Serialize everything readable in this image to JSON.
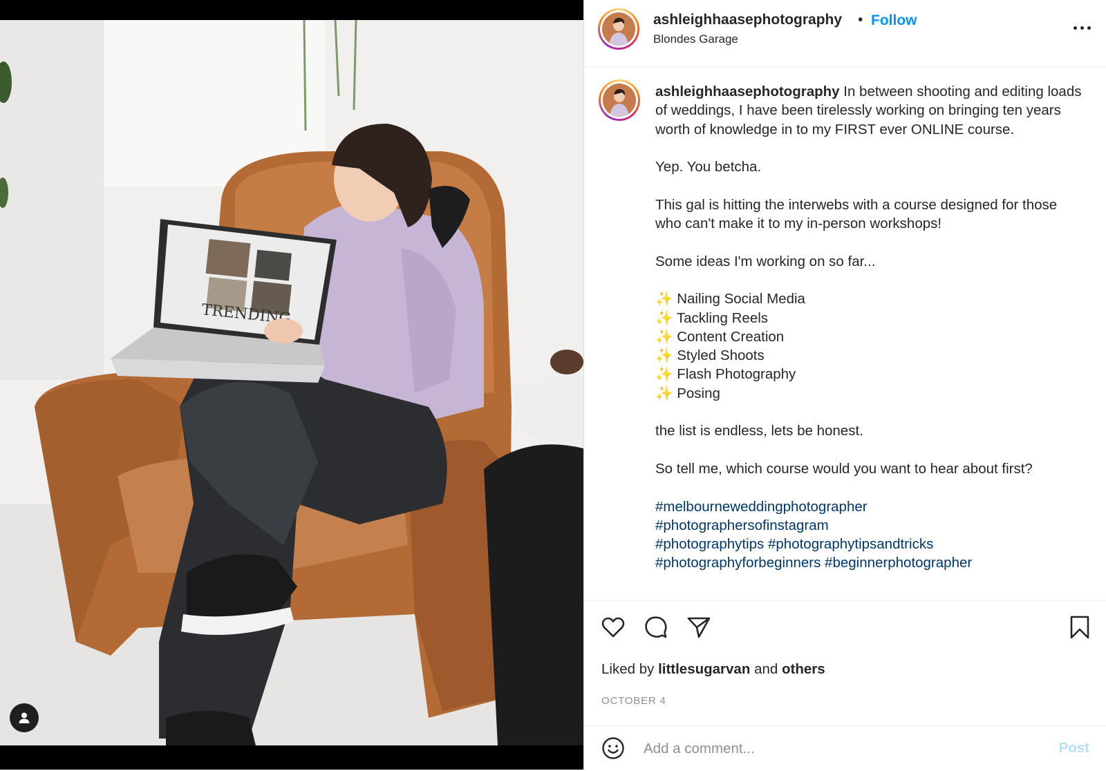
{
  "post": {
    "username": "ashleighhaasephotography",
    "separator": "•",
    "follow_label": "Follow",
    "location": "Blondes Garage",
    "more_icon": "more-horizontal-icon",
    "photo_screen_text": "TRENDING"
  },
  "caption": {
    "username": "ashleighhaasephotography",
    "intro": "In between shooting and editing loads of weddings, I have been tirelessly working on bringing ten years worth of knowledge in to my FIRST ever ONLINE course.",
    "line2": "Yep. You betcha.",
    "line3": "This gal is hitting the interwebs with a course designed for those who can't make it to my in-person workshops!",
    "line4": "Some ideas I'm working on so far...",
    "ideas": [
      "✨ Nailing Social Media",
      "✨ Tackling Reels",
      "✨ Content Creation",
      "✨ Styled Shoots",
      "✨ Flash Photography",
      "✨ Posing"
    ],
    "line5": "the list is endless, lets be honest.",
    "line6": "So tell me, which course would you want to hear about first?",
    "hashtags": [
      "#melbourneweddingphotographer",
      "#photographersofinstagram",
      "#photographytips",
      "#photographytipsandtricks",
      "#photographyforbeginners",
      "#beginnerphotographer"
    ]
  },
  "actions": {
    "liked_by_prefix": "Liked by",
    "liked_by_user": "littlesugarvan",
    "liked_by_and": "and",
    "liked_by_others": "others",
    "date": "OCTOBER 4",
    "comment_placeholder": "Add a comment...",
    "post_label": "Post"
  },
  "colors": {
    "follow": "#0095f6",
    "hashtag": "#00376b",
    "post_disabled": "#b2dffc"
  }
}
